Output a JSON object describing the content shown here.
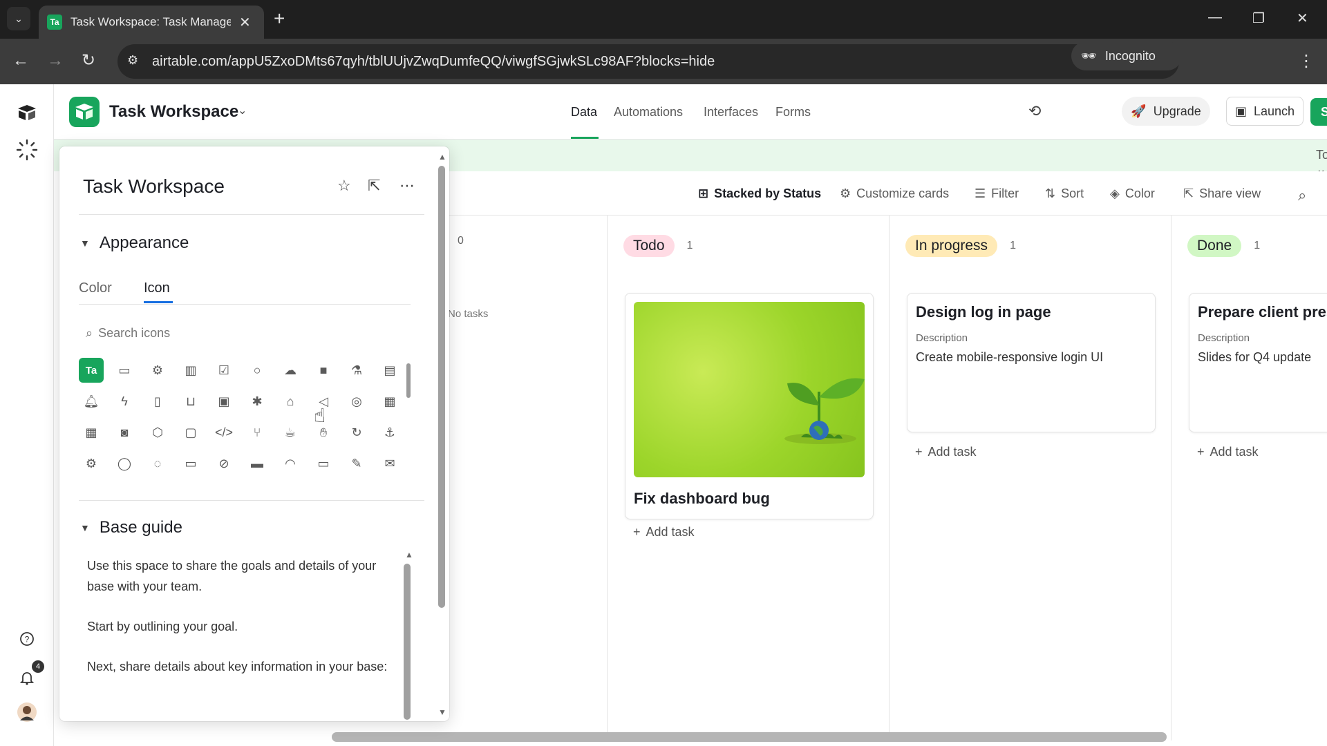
{
  "browser": {
    "tab_title": "Task Workspace: Task Manager",
    "tab_favicon": "Ta",
    "new_tab": "+",
    "url": "airtable.com/appU5ZxoDMts67qyh/tblUUjvZwqDumfeQQ/viwgfSGjwkSLc98AF?blocks=hide",
    "incognito_label": "Incognito"
  },
  "app": {
    "base_name": "Task Workspace",
    "nav_tabs": [
      "Data",
      "Automations",
      "Interfaces",
      "Forms"
    ],
    "active_nav": "Data",
    "upgrade_label": "Upgrade",
    "launch_label": "Launch",
    "share_label": "Share",
    "tools_label": "Tools",
    "notification_count": "4",
    "accent_color": "#18a55c"
  },
  "toolbar": {
    "stacked_by": "Stacked by Status",
    "customize": "Customize cards",
    "filter": "Filter",
    "sort": "Sort",
    "color": "Color",
    "share_view": "Share view"
  },
  "board": {
    "empty_stack": {
      "count": "0",
      "empty_text": "No tasks"
    },
    "stacks": [
      {
        "label": "Todo",
        "count": "1",
        "pill_bg": "#ffdbe4",
        "cards": [
          {
            "title": "Fix dashboard bug",
            "has_image": true
          }
        ],
        "add_label": "Add task"
      },
      {
        "label": "In progress",
        "count": "1",
        "pill_bg": "#ffeab6",
        "cards": [
          {
            "title": "Design log in page",
            "field": "Description",
            "desc": "Create mobile-responsive login UI"
          }
        ],
        "add_label": "Add task"
      },
      {
        "label": "Done",
        "count": "1",
        "pill_bg": "#d1f7c4",
        "cards": [
          {
            "title": "Prepare client pres",
            "field": "Description",
            "desc": "Slides for Q4 update"
          }
        ],
        "add_label": "Add task"
      }
    ]
  },
  "popover": {
    "title": "Task Workspace",
    "appearance_label": "Appearance",
    "subtabs": [
      "Color",
      "Icon"
    ],
    "active_subtab": "Icon",
    "search_placeholder": "Search icons",
    "selected_icon_text": "Ta",
    "icons": [
      [
        "ta",
        "folder-icon",
        "gear-icon",
        "bar-chart-icon",
        "checkbox-icon",
        "circle-icon",
        "cloud-icon",
        "square-icon",
        "flask-icon",
        "document-icon"
      ],
      [
        "bell-icon",
        "bolt-icon",
        "book-icon",
        "book-open-icon",
        "briefcase-icon",
        "bug-icon",
        "building-icon",
        "megaphone-icon",
        "target-icon",
        "calculator-icon"
      ],
      [
        "calendar-icon",
        "camera-icon",
        "cube-icon",
        "calendar-blank-icon",
        "code-icon",
        "git-branch-icon",
        "cup-icon",
        "hand-icon",
        "refresh-icon",
        "anchor-icon"
      ],
      [
        "gears-icon",
        "chat-icon",
        "chats-icon",
        "chat-square-icon",
        "compass-icon",
        "credit-card-icon",
        "gauge-icon",
        "desktop-icon",
        "pencil-icon",
        "envelope-icon"
      ]
    ],
    "guide_label": "Base guide",
    "guide_paragraphs": [
      "Use this space to share the goals and details of your base with your team.",
      "Start by outlining your goal.",
      "Next, share details about key information in your base:"
    ]
  }
}
